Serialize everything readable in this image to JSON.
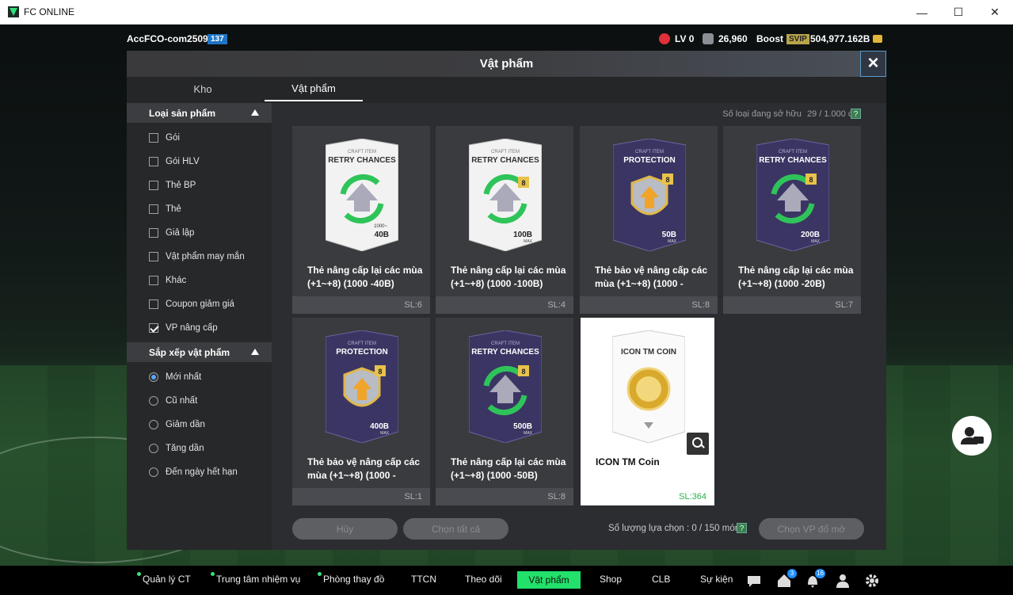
{
  "window": {
    "title": "FC ONLINE"
  },
  "status": {
    "account": "AccFCO-com2509g",
    "account_badge": "137",
    "lv": "LV 0",
    "points": "26,960",
    "boost_label": "Boost",
    "svip": "SVIP",
    "balance": "504,977.162B"
  },
  "modal": {
    "title": "Vật phẩm",
    "tabs": [
      {
        "label": "Kho"
      },
      {
        "label": "Vật phẩm"
      }
    ],
    "owned_label": "Số loại đang sở hữu",
    "owned_value": "29 / 1.000 cái",
    "help": "?",
    "selection_label": "Số lượng lựa chọn : 0 / 150 món",
    "buttons": {
      "cancel": "Hủy",
      "select_all": "Chọn tất cả",
      "select_item": "Chọn VP đổ mở"
    }
  },
  "sidebar": {
    "category_title": "Loại sản phẩm",
    "categories": [
      {
        "label": "Gói",
        "checked": false
      },
      {
        "label": "Gói HLV",
        "checked": false
      },
      {
        "label": "Thẻ BP",
        "checked": false
      },
      {
        "label": "Thẻ",
        "checked": false
      },
      {
        "label": "Giả lập",
        "checked": false
      },
      {
        "label": "Vật phẩm may mắn",
        "checked": false
      },
      {
        "label": "Khác",
        "checked": false
      },
      {
        "label": "Coupon giảm giá",
        "checked": false
      },
      {
        "label": "VP nâng cấp",
        "checked": true
      }
    ],
    "sort_title": "Sắp xếp vật phẩm",
    "sorts": [
      {
        "label": "Mới nhất",
        "selected": true
      },
      {
        "label": "Cũ nhất",
        "selected": false
      },
      {
        "label": "Giảm dần",
        "selected": false
      },
      {
        "label": "Tăng dần",
        "selected": false
      },
      {
        "label": "Đến ngày hết hạn",
        "selected": false
      }
    ]
  },
  "items": [
    {
      "name": "Thẻ nâng cấp lại các mùa (+1~+8) (1000 -40B)",
      "qty": "SL:6",
      "craft": "CRAFT ITEM",
      "kind": "RETRY CHANCES",
      "amount": "40B",
      "amount_top": "1000~",
      "style": "white"
    },
    {
      "name": "Thẻ nâng cấp lại các mùa (+1~+8) (1000 -100B)",
      "qty": "SL:4",
      "craft": "CRAFT ITEM",
      "kind": "RETRY CHANCES",
      "amount": "100B",
      "amount_top": "MAX",
      "style": "white"
    },
    {
      "name": "Thẻ bảo vệ nâng cấp các mùa (+1~+8) (1000 -",
      "qty": "SL:8",
      "craft": "CRAFT ITEM",
      "kind": "PROTECTION",
      "amount": "50B",
      "amount_top": "MAX",
      "style": "dark"
    },
    {
      "name": "Thẻ nâng cấp lại các mùa (+1~+8) (1000 -20B)",
      "qty": "SL:7",
      "craft": "CRAFT ITEM",
      "kind": "RETRY CHANCES",
      "amount": "200B",
      "amount_top": "MAX",
      "style": "dark"
    },
    {
      "name": "Thẻ bảo vệ nâng cấp các mùa (+1~+8) (1000 -",
      "qty": "SL:1",
      "craft": "CRAFT ITEM",
      "kind": "PROTECTION",
      "amount": "400B",
      "amount_top": "MAX",
      "style": "dark"
    },
    {
      "name": "Thẻ nâng cấp lại các mùa (+1~+8) (1000 -50B)",
      "qty": "SL:8",
      "craft": "CRAFT ITEM",
      "kind": "RETRY CHANCES",
      "amount": "500B",
      "amount_top": "MAX",
      "style": "dark"
    },
    {
      "name": "ICON TM Coin",
      "qty": "SL:364",
      "craft": "",
      "kind": "ICON TM COIN",
      "amount": "",
      "amount_top": "",
      "style": "coin"
    }
  ],
  "nav": {
    "items": [
      "Quản lý CT",
      "Trung tâm nhiệm vụ",
      "Phòng thay đồ",
      "TTCN",
      "Theo dõi",
      "Vật phẩm",
      "Shop",
      "CLB",
      "Sự kiện"
    ],
    "badges": {
      "home": "3",
      "bell": "16"
    }
  },
  "colors": {
    "accent": "#22e06a",
    "modal_bg": "#2c2d30",
    "selected_qty": "#2bb04a"
  }
}
